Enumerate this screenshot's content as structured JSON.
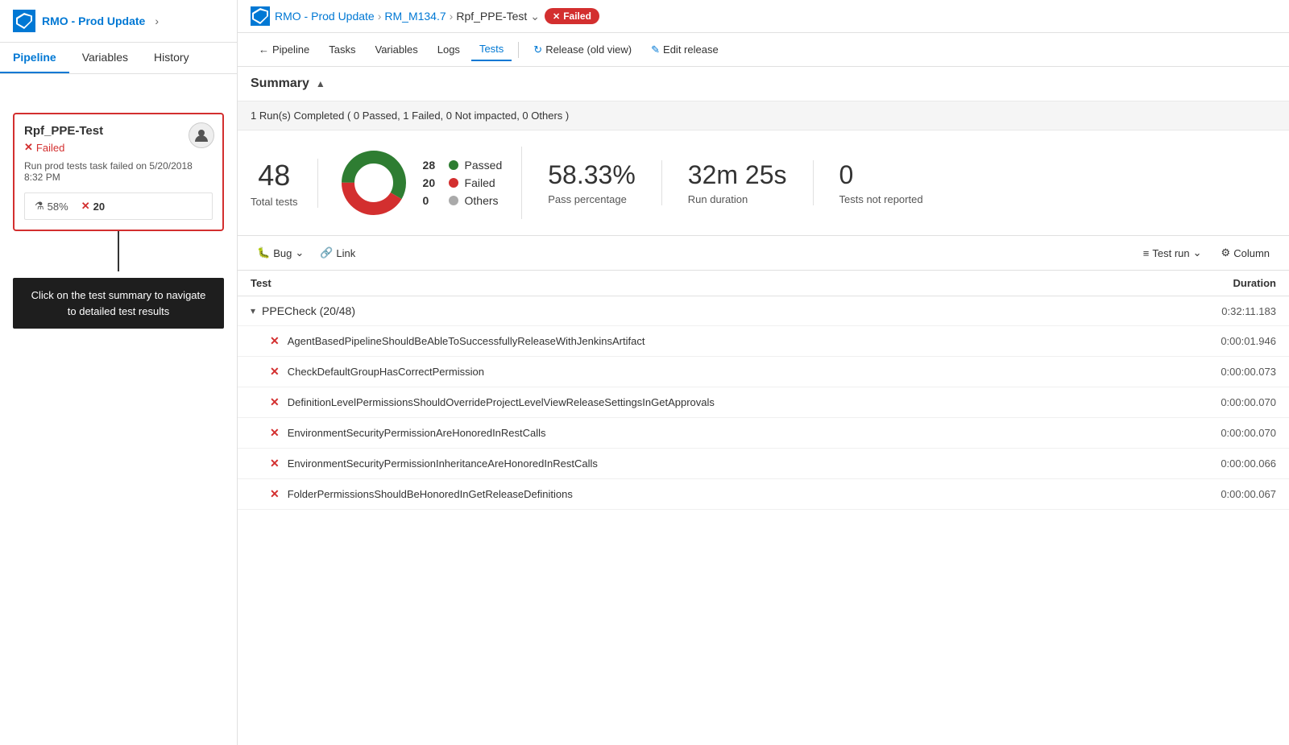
{
  "sidebar": {
    "logo_alt": "Azure DevOps",
    "pipeline_title": "RMO - Prod Update",
    "tabs": [
      {
        "id": "pipeline",
        "label": "Pipeline"
      },
      {
        "id": "variables",
        "label": "Variables"
      },
      {
        "id": "history",
        "label": "History"
      }
    ],
    "active_tab": "pipeline",
    "stage": {
      "name": "Rpf_PPE-Test",
      "status": "Failed",
      "description": "Run prod tests task failed on 5/20/2018 8:32 PM",
      "pass_pct": "58%",
      "fail_count": "20"
    },
    "tooltip": "Click on the test summary to navigate to detailed test results"
  },
  "topnav": {
    "breadcrumb": [
      {
        "label": "RMO - Prod Update",
        "type": "link"
      },
      {
        "label": "RM_M134.7",
        "type": "link"
      },
      {
        "label": "Rpf_PPE-Test",
        "type": "current"
      }
    ],
    "failed_label": "Failed"
  },
  "toolbar": {
    "back_label": "Pipeline",
    "tasks_label": "Tasks",
    "variables_label": "Variables",
    "logs_label": "Logs",
    "tests_label": "Tests",
    "release_old_label": "Release (old view)",
    "edit_release_label": "Edit release"
  },
  "summary": {
    "heading": "Summary",
    "run_info": "1 Run(s) Completed ( 0 Passed, 1 Failed, 0 Not impacted, 0 Others )",
    "total_tests": "48",
    "total_tests_label": "Total tests",
    "passed_count": "28",
    "failed_count": "20",
    "others_count": "0",
    "passed_label": "Passed",
    "failed_label": "Failed",
    "others_label": "Others",
    "pass_pct": "58.33%",
    "pass_pct_label": "Pass percentage",
    "duration": "32m 25s",
    "duration_label": "Run duration",
    "not_reported": "0",
    "not_reported_label": "Tests not reported",
    "donut": {
      "passed_pct": 58.33,
      "failed_pct": 41.67,
      "passed_color": "#2e7d32",
      "failed_color": "#d32f2f"
    }
  },
  "test_toolbar": {
    "bug_label": "Bug",
    "link_label": "Link",
    "test_run_label": "Test run",
    "column_label": "Column"
  },
  "table": {
    "col_test": "Test",
    "col_duration": "Duration",
    "groups": [
      {
        "name": "PPECheck (20/48)",
        "duration": "0:32:11.183",
        "rows": [
          {
            "name": "AgentBasedPipelineShouldBeAbleToSuccessfullyReleaseWithJenkinsArtifact",
            "duration": "0:00:01.946",
            "status": "failed"
          },
          {
            "name": "CheckDefaultGroupHasCorrectPermission",
            "duration": "0:00:00.073",
            "status": "failed"
          },
          {
            "name": "DefinitionLevelPermissionsShouldOverrideProjectLevelViewReleaseSettingsInGetApprovals",
            "duration": "0:00:00.070",
            "status": "failed"
          },
          {
            "name": "EnvironmentSecurityPermissionAreHonoredInRestCalls",
            "duration": "0:00:00.070",
            "status": "failed"
          },
          {
            "name": "EnvironmentSecurityPermissionInheritanceAreHonoredInRestCalls",
            "duration": "0:00:00.066",
            "status": "failed"
          },
          {
            "name": "FolderPermissionsShouldBeHonoredInGetReleaseDefinitions",
            "duration": "0:00:00.067",
            "status": "failed"
          }
        ]
      }
    ]
  }
}
